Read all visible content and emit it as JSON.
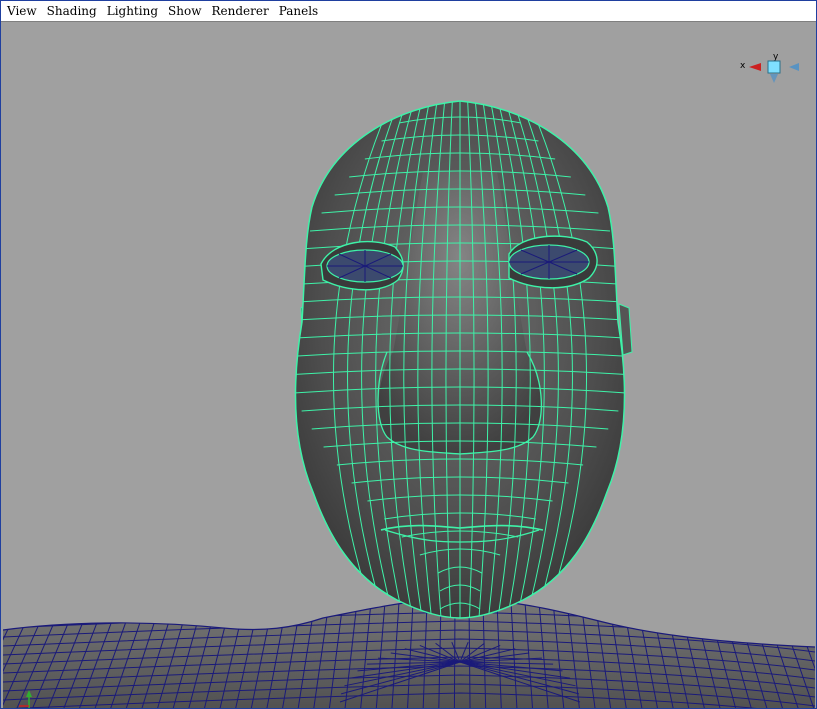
{
  "menubar": {
    "items": [
      {
        "id": "view",
        "label": "View"
      },
      {
        "id": "shading",
        "label": "Shading"
      },
      {
        "id": "lighting",
        "label": "Lighting"
      },
      {
        "id": "show",
        "label": "Show"
      },
      {
        "id": "renderer",
        "label": "Renderer"
      },
      {
        "id": "panels",
        "label": "Panels"
      }
    ]
  },
  "viewcube": {
    "axis_y_label": "y",
    "axis_x_label": "x",
    "colors": {
      "x": "#cc2020",
      "y": "#30b030",
      "z": "#2a8ad8",
      "center": "#7fe0ff"
    }
  },
  "viewport": {
    "background": "#a0a0a0",
    "selected_wire_color": "#3ef2a8",
    "body_wire_color": "#1a1a7a",
    "surface_color": "#585858"
  }
}
